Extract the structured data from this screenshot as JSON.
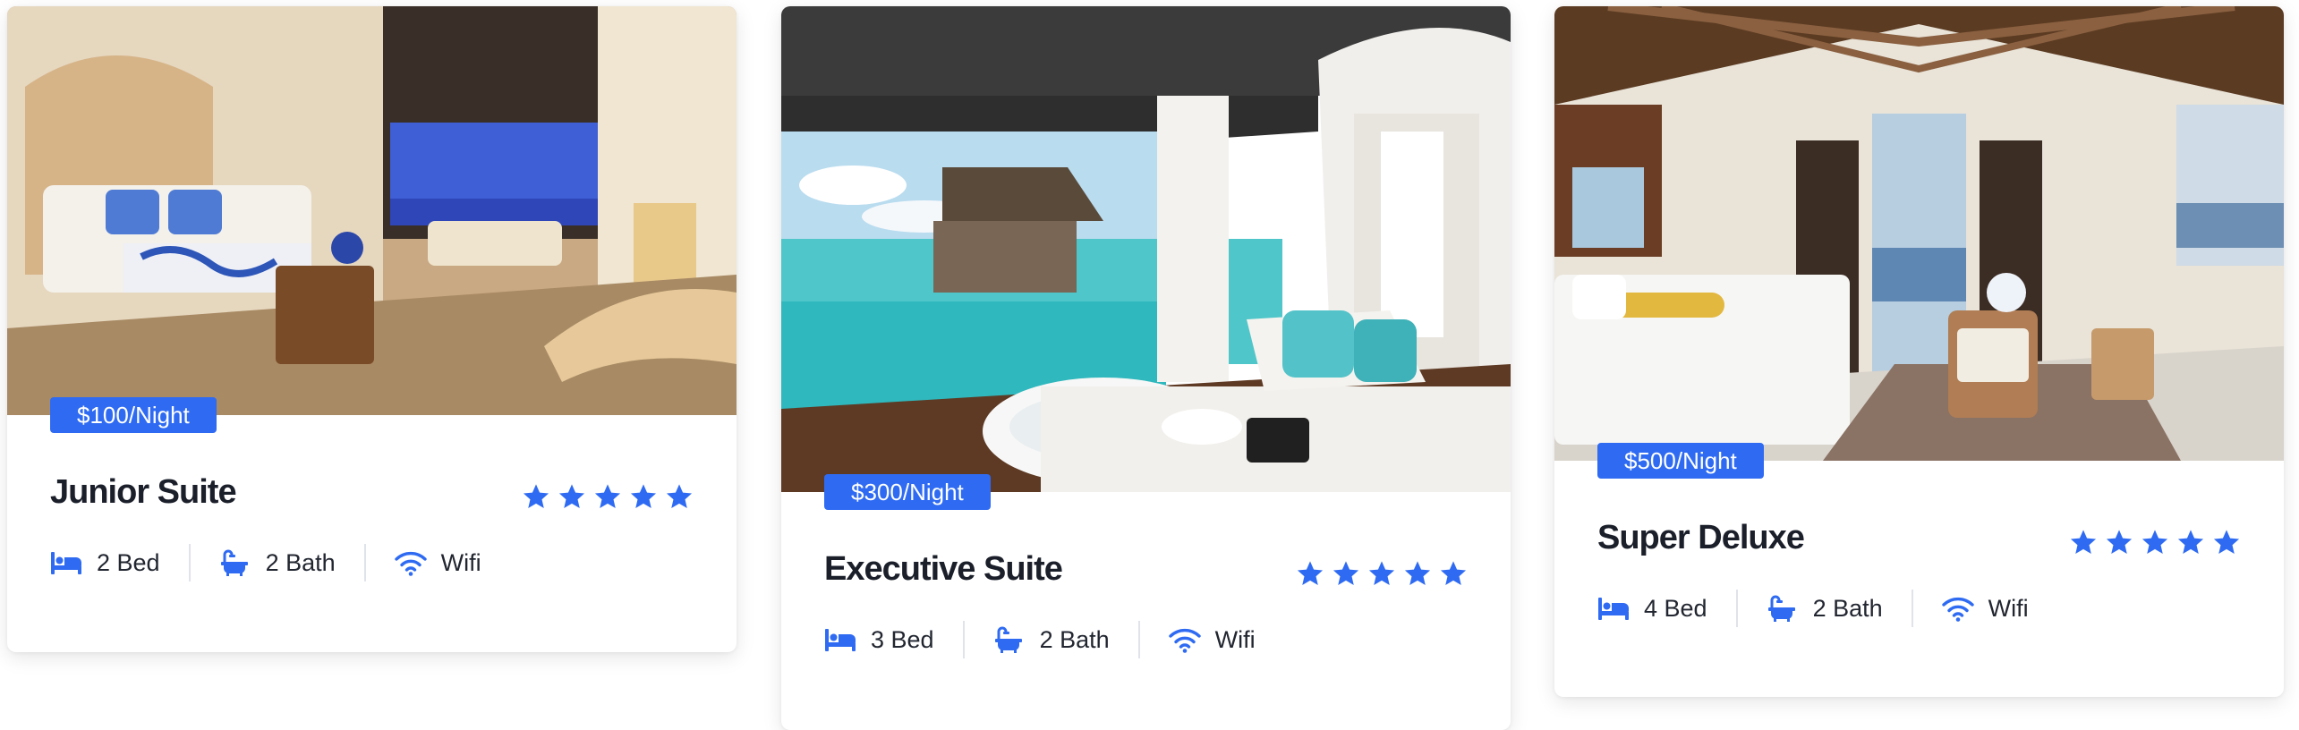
{
  "theme": {
    "accent": "#2f6bf2",
    "text": "#1b1f2a"
  },
  "rooms": [
    {
      "price": "$100/Night",
      "name": "Junior Suite",
      "rating": 5,
      "features": [
        {
          "icon": "bed-icon",
          "label": "2 Bed"
        },
        {
          "icon": "bath-icon",
          "label": "2 Bath"
        },
        {
          "icon": "wifi-icon",
          "label": "Wifi"
        }
      ]
    },
    {
      "price": "$300/Night",
      "name": "Executive Suite",
      "rating": 5,
      "features": [
        {
          "icon": "bed-icon",
          "label": "3 Bed"
        },
        {
          "icon": "bath-icon",
          "label": "2 Bath"
        },
        {
          "icon": "wifi-icon",
          "label": "Wifi"
        }
      ]
    },
    {
      "price": "$500/Night",
      "name": "Super Deluxe",
      "rating": 5,
      "features": [
        {
          "icon": "bed-icon",
          "label": "4 Bed"
        },
        {
          "icon": "bath-icon",
          "label": "2 Bath"
        },
        {
          "icon": "wifi-icon",
          "label": "Wifi"
        }
      ]
    }
  ]
}
